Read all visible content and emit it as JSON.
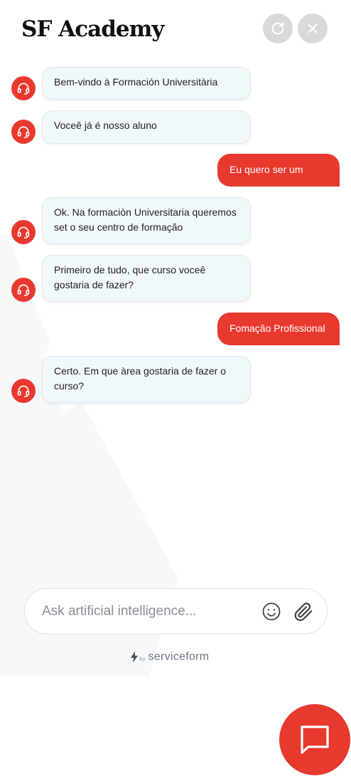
{
  "header": {
    "title": "SF Academy",
    "refresh_icon": "refresh-icon",
    "close_icon": "close-icon"
  },
  "messages": [
    {
      "sender": "bot",
      "text": "Bem-vindo à Formación Universitària"
    },
    {
      "sender": "bot",
      "text": "Voceê já é nosso aluno"
    },
    {
      "sender": "user",
      "text": "Eu quero ser um"
    },
    {
      "sender": "bot",
      "text": "Ok. Na formaciòn Universitaria queremos set o seu centro de formação"
    },
    {
      "sender": "bot",
      "text": "Primeiro de tudo, que curso voceê gostaria de fazer?"
    },
    {
      "sender": "user",
      "text": "Fomação Profissional"
    },
    {
      "sender": "bot",
      "text": "Certo. Em que àrea gostaria de fazer o curso?"
    }
  ],
  "input": {
    "placeholder": "Ask artificial intelligence...",
    "value": "",
    "emoji_icon": "emoji-icon",
    "attach_icon": "paperclip-icon"
  },
  "footer": {
    "by_label": "by",
    "brand": "serviceform",
    "bolt_icon": "bolt-icon"
  },
  "fab": {
    "icon": "chat-bubble-icon"
  },
  "colors": {
    "accent": "#e8392f",
    "bot_bubble": "#f1f8fb",
    "header_button": "#d9d9d9"
  }
}
